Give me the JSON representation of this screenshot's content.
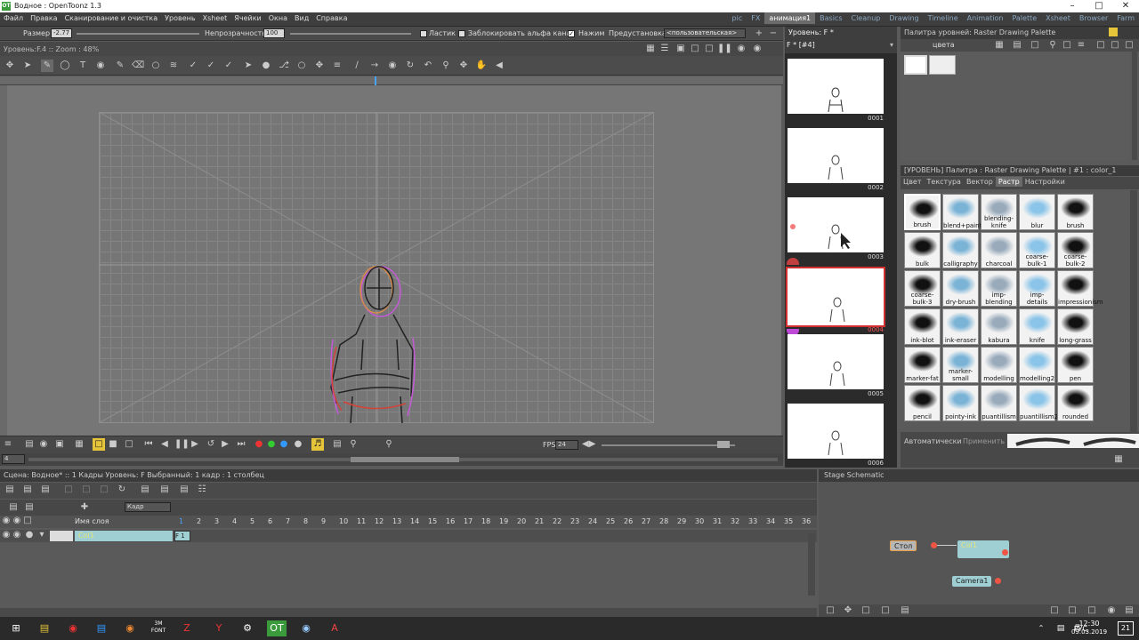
{
  "window": {
    "title": "Водное : OpenToonz 1.3",
    "logo": "OT"
  },
  "menu": [
    "Файл",
    "Правка",
    "Сканирование и очистка",
    "Уровень",
    "Xsheet",
    "Ячейки",
    "Окна",
    "Вид",
    "Справка"
  ],
  "rooms": [
    {
      "label": "pic"
    },
    {
      "label": "FX"
    },
    {
      "label": "анимация1",
      "active": true
    },
    {
      "label": "Basics"
    },
    {
      "label": "Cleanup"
    },
    {
      "label": "Drawing"
    },
    {
      "label": "Timeline"
    },
    {
      "label": "Animation"
    },
    {
      "label": "Palette"
    },
    {
      "label": "Xsheet"
    },
    {
      "label": "Browser"
    },
    {
      "label": "Farm"
    }
  ],
  "options": {
    "size_label": "Размер",
    "size_value": "-2.77",
    "opacity_label": "Непрозрачность",
    "opacity_value": "100",
    "eraser_label": "Ластик",
    "lock_alpha_label": "Заблокировать альфа канал",
    "pressure_label": "Нажим",
    "preset_label": "Предустановка:",
    "preset_value": "<пользовательская>"
  },
  "viewer": {
    "header": "Уровень:F.4  ::  Zoom : 48%"
  },
  "playback": {
    "fps_label": "FPS",
    "fps_value": "24",
    "frame_value": "4"
  },
  "level_strip": {
    "title": "Уровень: F *",
    "level": "F * [#4]",
    "frames": [
      "0001",
      "0002",
      "0003",
      "0004",
      "0005",
      "0006"
    ]
  },
  "palette": {
    "title": "Палитра уровней: Raster Drawing Palette",
    "name": "цвета"
  },
  "style": {
    "title": "[УРОВЕНЬ]  Палитра : Raster Drawing Palette | #1 : color_1",
    "tabs": [
      "Цвет",
      "Текстура",
      "Вектор",
      "Растр",
      "Настройки"
    ],
    "active_tab": "Растр",
    "auto_label": "Автоматически",
    "apply_label": "Применить"
  },
  "brushes": [
    "brush",
    "blend+paint",
    "blending-knife",
    "blur",
    "brush",
    "bulk",
    "calligraphy",
    "charcoal",
    "coarse-bulk-1",
    "coarse-bulk-2",
    "coarse-bulk-3",
    "dry-brush",
    "imp-blending",
    "imp-details",
    "impressionism",
    "ink-blot",
    "ink-eraser",
    "kabura",
    "knife",
    "long-grass",
    "marker-fat",
    "marker-small",
    "modelling",
    "modelling2",
    "pen",
    "pencil",
    "pointy-ink",
    "puantillism",
    "puantillism2",
    "rounded"
  ],
  "xsheet": {
    "scene_info": "Сцена: Водное*  ::  1 Кадры  Уровень: F  Выбранный: 1 кадр : 1 столбец",
    "frame_mode": "Кадр",
    "layer_name_label": "Имя слоя",
    "column_name": "Col1",
    "cell": "F 1",
    "frame_numbers": [
      "1",
      "2",
      "3",
      "4",
      "5",
      "6",
      "7",
      "8",
      "9",
      "10",
      "11",
      "12",
      "13",
      "14",
      "15",
      "16",
      "17",
      "18",
      "19",
      "20",
      "21",
      "22",
      "23",
      "24",
      "25",
      "26",
      "27",
      "28",
      "29",
      "30",
      "31",
      "32",
      "33",
      "34",
      "35",
      "36"
    ]
  },
  "schematic": {
    "title": "Stage Schematic",
    "table": "Стол",
    "col": "Col1",
    "camera": "Camera1"
  },
  "taskbar": {
    "lang": "РУС",
    "time": "12:30",
    "date": "09.03.2019",
    "notif": "21"
  }
}
